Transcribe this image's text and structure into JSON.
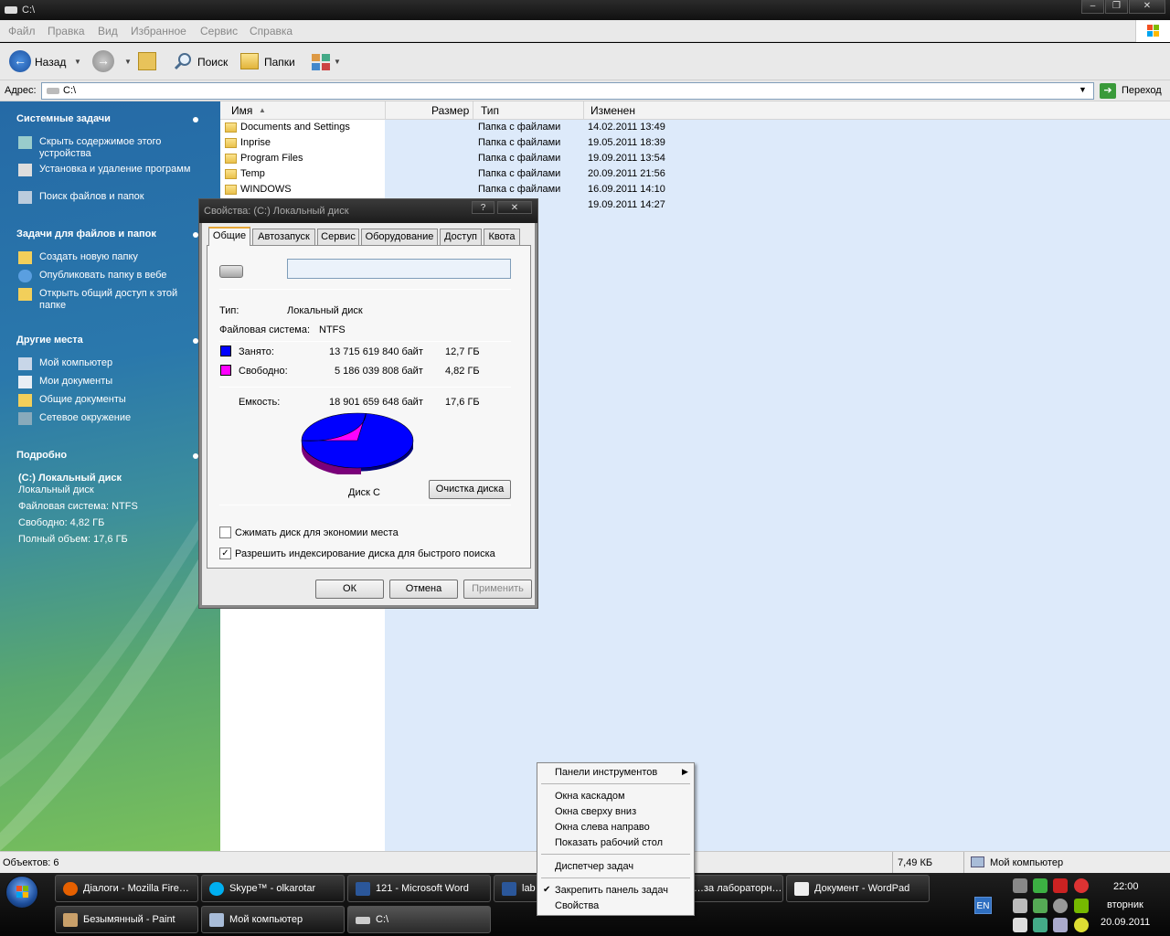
{
  "window": {
    "title": "C:\\"
  },
  "menu": [
    "Файл",
    "Правка",
    "Вид",
    "Избранное",
    "Сервис",
    "Справка"
  ],
  "toolbar": {
    "back": "Назад",
    "search": "Поиск",
    "folders": "Папки"
  },
  "address": {
    "label": "Адрес:",
    "value": "C:\\",
    "go": "Переход"
  },
  "sidebar": {
    "system_tasks": {
      "title": "Системные задачи",
      "items": [
        "Скрыть содержимое этого устройства",
        "Установка и удаление программ",
        "Поиск файлов и папок"
      ]
    },
    "file_tasks": {
      "title": "Задачи для файлов и папок",
      "items": [
        "Создать новую папку",
        "Опубликовать папку в вебе",
        "Открыть общий доступ к этой папке"
      ]
    },
    "other_places": {
      "title": "Другие места",
      "items": [
        "Мой компьютер",
        "Мои документы",
        "Общие документы",
        "Сетевое окружение"
      ]
    },
    "details": {
      "title": "Подробно",
      "name": "(C:) Локальный диск",
      "type": "Локальный диск",
      "fs": "Файловая система: NTFS",
      "free": "Свободно: 4,82 ГБ",
      "total": "Полный объем: 17,6 ГБ"
    }
  },
  "columns": {
    "name": "Имя",
    "size": "Размер",
    "type": "Тип",
    "modified": "Изменен"
  },
  "files": [
    {
      "name": "Documents and Settings",
      "type": "Папка с файлами",
      "modified": "14.02.2011 13:49"
    },
    {
      "name": "Inprise",
      "type": "Папка с файлами",
      "modified": "19.05.2011 18:39"
    },
    {
      "name": "Program Files",
      "type": "Папка с файлами",
      "modified": "19.09.2011 13:54"
    },
    {
      "name": "Temp",
      "type": "Папка с файлами",
      "modified": "20.09.2011 21:56"
    },
    {
      "name": "WINDOWS",
      "type": "Папка с файлами",
      "modified": "16.09.2011 14:10"
    },
    {
      "name": "",
      "type": "",
      "modified": "19.09.2011 14:27"
    }
  ],
  "dialog": {
    "title": "Свойства: (C:) Локальный диск",
    "tabs": [
      "Общие",
      "Автозапуск",
      "Сервис",
      "Оборудование",
      "Доступ",
      "Квота"
    ],
    "name_value": "",
    "type_label": "Тип:",
    "type_value": "Локальный диск",
    "fs_label": "Файловая система:",
    "fs_value": "NTFS",
    "used_label": "Занято:",
    "used_bytes": "13 715 619 840 байт",
    "used_gb": "12,7 ГБ",
    "free_label": "Свободно:",
    "free_bytes": "5 186 039 808 байт",
    "free_gb": "4,82 ГБ",
    "cap_label": "Емкость:",
    "cap_bytes": "18 901 659 648 байт",
    "cap_gb": "17,6 ГБ",
    "disk_label": "Диск C",
    "cleanup": "Очистка диска",
    "compress": "Сжимать диск для экономии места",
    "index": "Разрешить индексирование диска для быстрого поиска",
    "ok": "ОК",
    "cancel": "Отмена",
    "apply": "Применить",
    "colors": {
      "used": "#0000ff",
      "free": "#ff00ff"
    },
    "used_fraction": 0.7256
  },
  "status": {
    "objects": "Объектов: 6",
    "size": "7,49 КБ",
    "location": "Мой компьютер"
  },
  "context_menu": {
    "toolbars": "Панели инструментов",
    "cascade": "Окна каскадом",
    "tile_h": "Окна сверху вниз",
    "tile_v": "Окна слева направо",
    "show_desktop": "Показать рабочий стол",
    "task_manager": "Диспетчер задач",
    "lock": "Закрепить панель задач",
    "properties": "Свойства"
  },
  "taskbar": {
    "row1": [
      "Діалоги - Mozilla Fire…",
      "Skype™ - olkarotar",
      "121 - Microsoft Word",
      "lab…",
      "…за лабораторн…",
      "Документ - WordPad"
    ],
    "row2": [
      "Безымянный - Paint",
      "Мой компьютер",
      "C:\\"
    ],
    "lang": "EN",
    "time": "22:00",
    "day": "вторник",
    "date": "20.09.2011"
  }
}
